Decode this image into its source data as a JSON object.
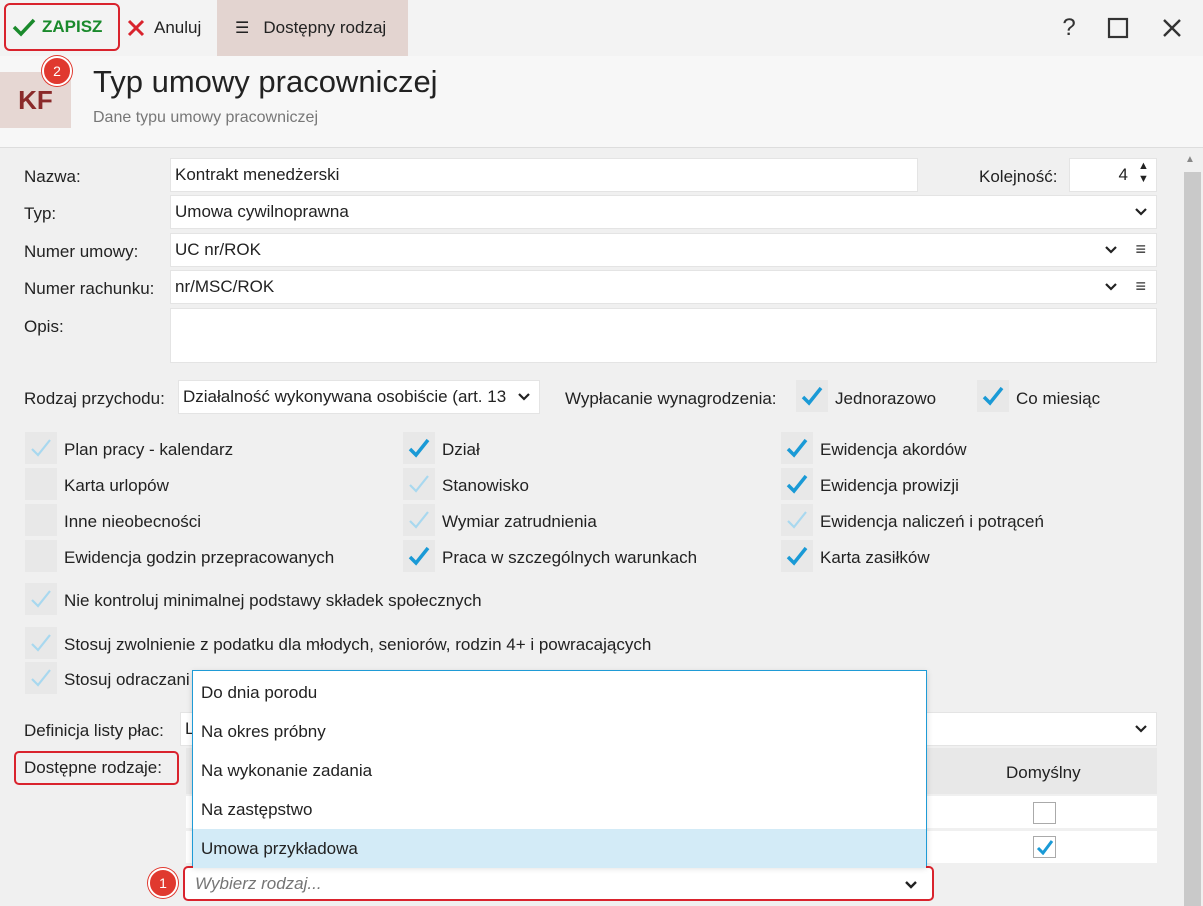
{
  "toolbar": {
    "save_label": "ZAPISZ",
    "cancel_label": "Anuluj",
    "dostepny_label": "Dostępny rodzaj",
    "help": "?",
    "maximize": "☐",
    "close": "✕"
  },
  "header": {
    "logo": "KF",
    "title": "Typ umowy pracowniczej",
    "subtitle": "Dane typu umowy pracowniczej"
  },
  "badges": {
    "one": "1",
    "two": "2"
  },
  "form": {
    "nazwa_label": "Nazwa:",
    "nazwa_value": "Kontrakt menedżerski",
    "kolejnosc_label": "Kolejność:",
    "kolejnosc_value": "4",
    "typ_label": "Typ:",
    "typ_value": "Umowa cywilnoprawna",
    "numer_umowy_label": "Numer umowy:",
    "numer_umowy_value": "UC nr/ROK",
    "numer_rachunku_label": "Numer rachunku:",
    "numer_rachunku_value": "nr/MSC/ROK",
    "opis_label": "Opis:",
    "rodzaj_przychodu_label": "Rodzaj przychodu:",
    "rodzaj_przychodu_value": "Działalność wykonywana osobiście (art. 13",
    "wyplacanie_label": "Wypłacanie wynagrodzenia:",
    "jednorazowo_label": "Jednorazowo",
    "co_miesiac_label": "Co miesiąc",
    "definicja_label": "Definicja listy płac:",
    "definicja_value": "L",
    "dostepne_label": "Dostępne rodzaje:",
    "wybierz_placeholder": "Wybierz rodzaj...",
    "domyslny_header": "Domyślny"
  },
  "checkboxes": {
    "col1": [
      {
        "label": "Plan pracy - kalendarz",
        "state": "light"
      },
      {
        "label": "Karta urlopów",
        "state": "empty"
      },
      {
        "label": "Inne nieobecności",
        "state": "empty"
      },
      {
        "label": "Ewidencja godzin przepracowanych",
        "state": "empty"
      }
    ],
    "col2": [
      {
        "label": "Dział",
        "state": "checked"
      },
      {
        "label": "Stanowisko",
        "state": "light"
      },
      {
        "label": "Wymiar zatrudnienia",
        "state": "light"
      },
      {
        "label": "Praca w szczególnych warunkach",
        "state": "checked"
      }
    ],
    "col3": [
      {
        "label": "Ewidencja akordów",
        "state": "checked"
      },
      {
        "label": "Ewidencja prowizji",
        "state": "checked"
      },
      {
        "label": "Ewidencja naliczeń i potrąceń",
        "state": "light"
      },
      {
        "label": "Karta zasiłków",
        "state": "checked"
      }
    ],
    "wide": [
      {
        "label": "Nie kontroluj minimalnej podstawy składek społecznych",
        "state": "light"
      },
      {
        "label": "Stosuj zwolnienie z podatku dla młodych, seniorów, rodzin 4+ i powracających",
        "state": "light"
      },
      {
        "label": "Stosuj odraczani",
        "state": "light"
      }
    ]
  },
  "dropdown_options": [
    "Do dnia porodu",
    "Na okres próbny",
    "Na wykonanie zadania",
    "Na zastępstwo",
    "Umowa przykładowa"
  ],
  "dropdown_selected": "Umowa przykładowa",
  "colors": {
    "check_blue": "#1a9ad6",
    "check_light": "#a8d8ef",
    "highlight_red": "#d9232d",
    "save_green": "#1a8a2c"
  }
}
